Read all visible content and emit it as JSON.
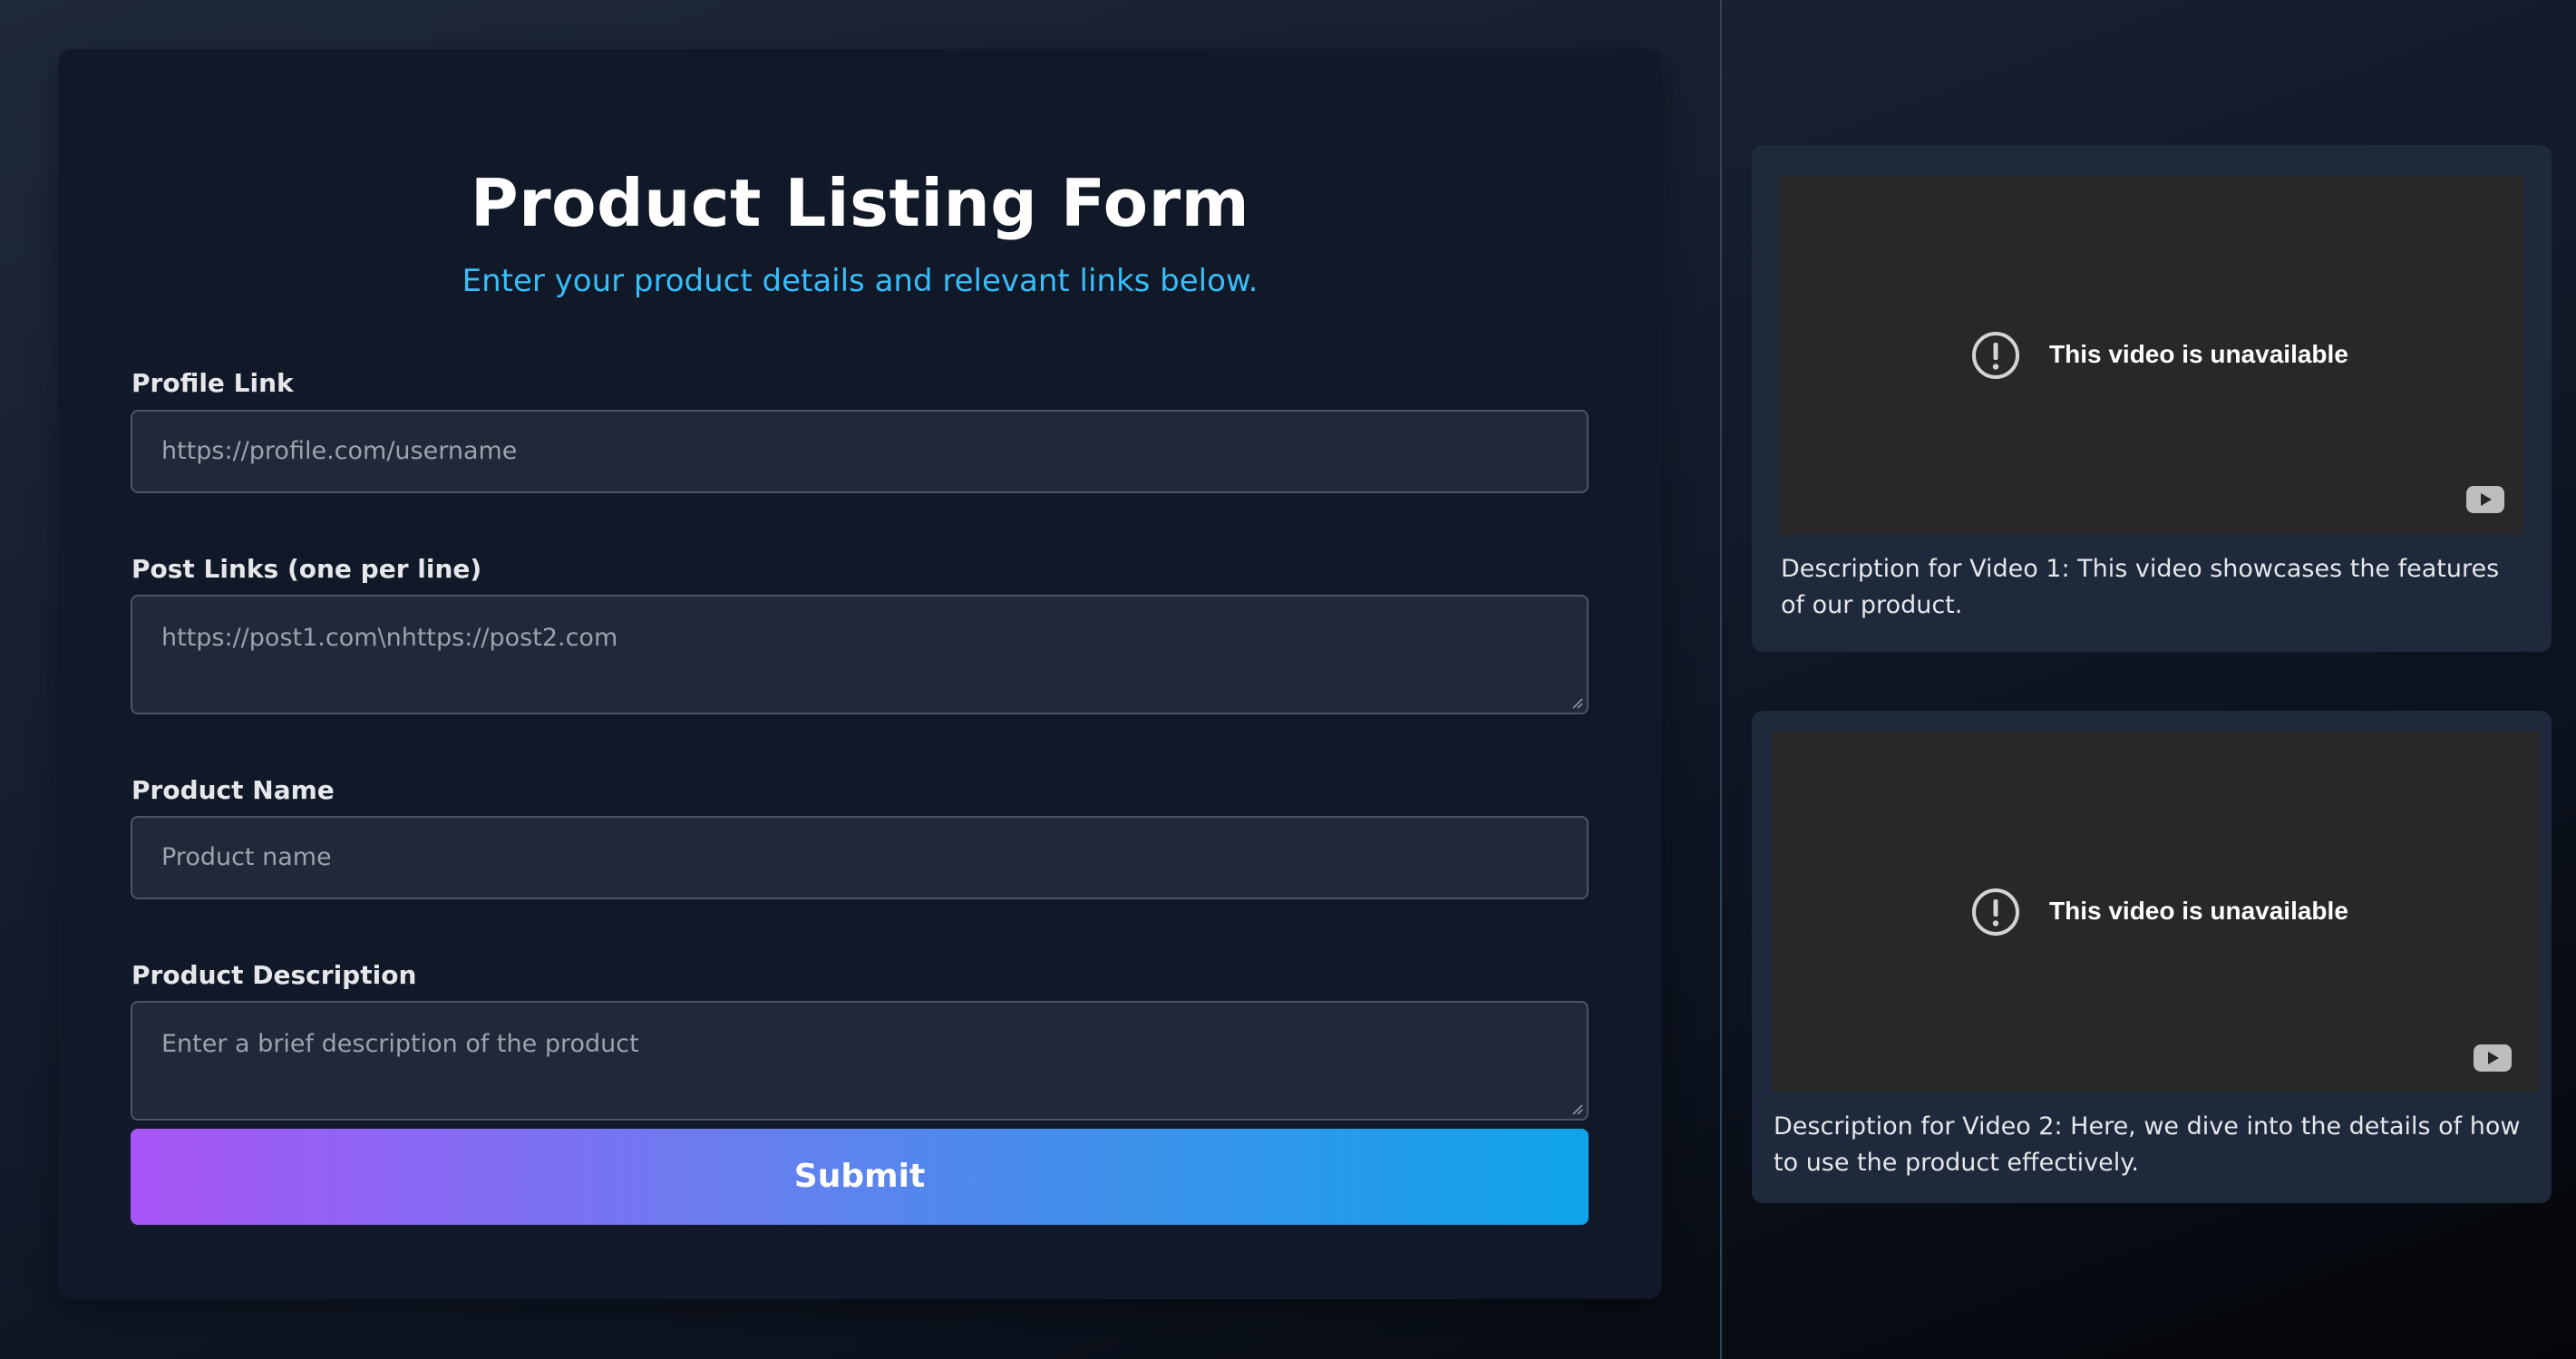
{
  "form": {
    "title": "Product Listing Form",
    "subtitle": "Enter your product details and relevant links below.",
    "fields": {
      "profile_link": {
        "label": "Profile Link",
        "placeholder": "https://profile.com/username",
        "value": ""
      },
      "post_links": {
        "label": "Post Links (one per line)",
        "placeholder": "https://post1.com\\nhttps://post2.com",
        "value": ""
      },
      "product_name": {
        "label": "Product Name",
        "placeholder": "Product name",
        "value": ""
      },
      "product_description": {
        "label": "Product Description",
        "placeholder": "Enter a brief description of the product",
        "value": ""
      }
    },
    "submit_label": "Submit"
  },
  "videos": [
    {
      "status_text": "This video is unavailable",
      "status_icon": "alert-circle-icon",
      "player_icon": "youtube-logo-icon",
      "description": "Description for Video 1: This video showcases the features of our product."
    },
    {
      "status_text": "This video is unavailable",
      "status_icon": "alert-circle-icon",
      "player_icon": "youtube-logo-icon",
      "description": "Description for Video 2: Here, we dive into the details of how to use the product effectively."
    }
  ],
  "colors": {
    "page_background": "#111827",
    "card_background": "#111827",
    "input_background": "#1f2937",
    "subtitle_accent": "#38bdf8",
    "button_gradient_start": "#a855f7",
    "button_gradient_end": "#0ea5e9",
    "video_card_background": "#1e293b",
    "video_frame_background": "#282828"
  }
}
